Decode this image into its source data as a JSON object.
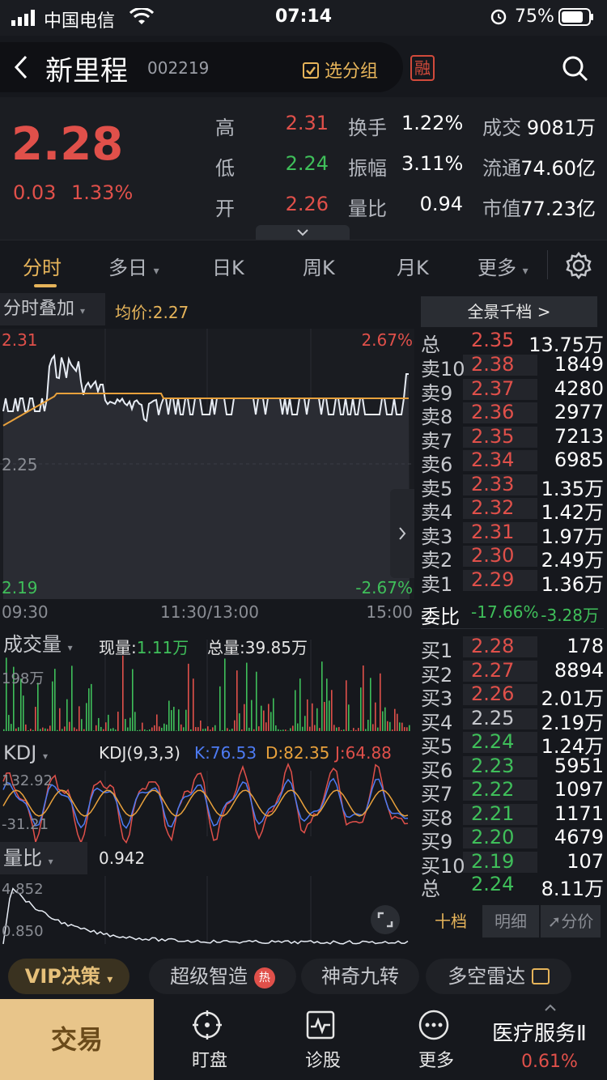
{
  "status_bar": {
    "carrier": "中国电信",
    "time": "07:14",
    "battery": "75%"
  },
  "header": {
    "title": "新里程",
    "code": "002219",
    "group_button": "选分组",
    "margin_badge": "融"
  },
  "quote": {
    "price": "2.28",
    "change": "0.03",
    "change_pct": "1.33%",
    "rows": [
      [
        {
          "label": "高",
          "value": "2.31",
          "color": "#e0504a"
        },
        {
          "label": "换手",
          "value": "1.22%",
          "color": "#ffffff"
        },
        {
          "label": "成交",
          "value": "9081万",
          "color": "#ffffff"
        }
      ],
      [
        {
          "label": "低",
          "value": "2.24",
          "color": "#3fbf5a"
        },
        {
          "label": "振幅",
          "value": "3.11%",
          "color": "#ffffff"
        },
        {
          "label": "流通",
          "value": "74.60亿",
          "color": "#ffffff"
        }
      ],
      [
        {
          "label": "开",
          "value": "2.26",
          "color": "#e0504a"
        },
        {
          "label": "量比",
          "value": "0.94",
          "color": "#ffffff"
        },
        {
          "label": "市值",
          "value": "77.23亿",
          "color": "#ffffff"
        }
      ]
    ]
  },
  "tabs": [
    "分时",
    "多日",
    "日K",
    "周K",
    "月K",
    "更多"
  ],
  "intraday": {
    "overlay_label": "分时叠加",
    "avg_label": "均价:",
    "avg_value": "2.27",
    "price_high": "2.31",
    "price_mid": "2.25",
    "price_low": "2.19",
    "pct_high": "2.67%",
    "pct_low": "-2.67%",
    "time_start": "09:30",
    "time_mid": "11:30/13:00",
    "time_end": "15:00"
  },
  "volume": {
    "label": "成交量",
    "current_label": "现量:",
    "current_value": "1.11万",
    "total_label": "总量:",
    "total_value": "39.85万",
    "axis_max": "198万"
  },
  "kdj": {
    "label": "KDJ",
    "params": "KDJ(9,3,3)",
    "k": "K:76.53",
    "d": "D:82.35",
    "j": "J:64.88",
    "axis_top": "132.92",
    "axis_bottom": "-31.21"
  },
  "volume_ratio": {
    "label": "量比",
    "value": "0.942",
    "axis_top": "4.852",
    "axis_bottom": "0.850"
  },
  "order_book": {
    "header": "全景千档 >",
    "total_sell": {
      "name": "总",
      "price": "2.35",
      "vol": "13.75万"
    },
    "sells": [
      {
        "name": "卖10",
        "price": "2.38",
        "vol": "1849"
      },
      {
        "name": "卖9",
        "price": "2.37",
        "vol": "4280"
      },
      {
        "name": "卖8",
        "price": "2.36",
        "vol": "2977"
      },
      {
        "name": "卖7",
        "price": "2.35",
        "vol": "7213"
      },
      {
        "name": "卖6",
        "price": "2.34",
        "vol": "6985"
      },
      {
        "name": "卖5",
        "price": "2.33",
        "vol": "1.35万"
      },
      {
        "name": "卖4",
        "price": "2.32",
        "vol": "1.42万"
      },
      {
        "name": "卖3",
        "price": "2.31",
        "vol": "1.97万"
      },
      {
        "name": "卖2",
        "price": "2.30",
        "vol": "2.49万"
      },
      {
        "name": "卖1",
        "price": "2.29",
        "vol": "1.36万"
      }
    ],
    "committee": {
      "label": "委比",
      "pct": "-17.66%",
      "diff": "-3.28万"
    },
    "buys": [
      {
        "name": "买1",
        "price": "2.28",
        "vol": "178"
      },
      {
        "name": "买2",
        "price": "2.27",
        "vol": "8894"
      },
      {
        "name": "买3",
        "price": "2.26",
        "vol": "2.01万"
      },
      {
        "name": "买4",
        "price": "2.25",
        "vol": "2.19万"
      },
      {
        "name": "买5",
        "price": "2.24",
        "vol": "1.24万"
      },
      {
        "name": "买6",
        "price": "2.23",
        "vol": "5951"
      },
      {
        "name": "买7",
        "price": "2.22",
        "vol": "1097"
      },
      {
        "name": "买8",
        "price": "2.21",
        "vol": "1171"
      },
      {
        "name": "买9",
        "price": "2.20",
        "vol": "4679"
      },
      {
        "name": "买10",
        "price": "2.19",
        "vol": "107"
      }
    ],
    "total_buy": {
      "name": "总",
      "price": "2.24",
      "vol": "8.11万"
    },
    "tabs": [
      "十档",
      "明细",
      "分价"
    ]
  },
  "tools": {
    "vip": "VIP决策",
    "items": [
      "超级智造",
      "神奇九转",
      "多空雷达"
    ],
    "hot_badge": "热"
  },
  "bottom": {
    "trade": "交易",
    "items": [
      "盯盘",
      "诊股",
      "更多"
    ],
    "sector_name": "医疗服务Ⅱ",
    "sector_pct": "0.61%"
  },
  "colors": {
    "up": "#e0504a",
    "down": "#3fbf5a",
    "accent": "#e6b45a",
    "neutral": "#ffffff"
  }
}
